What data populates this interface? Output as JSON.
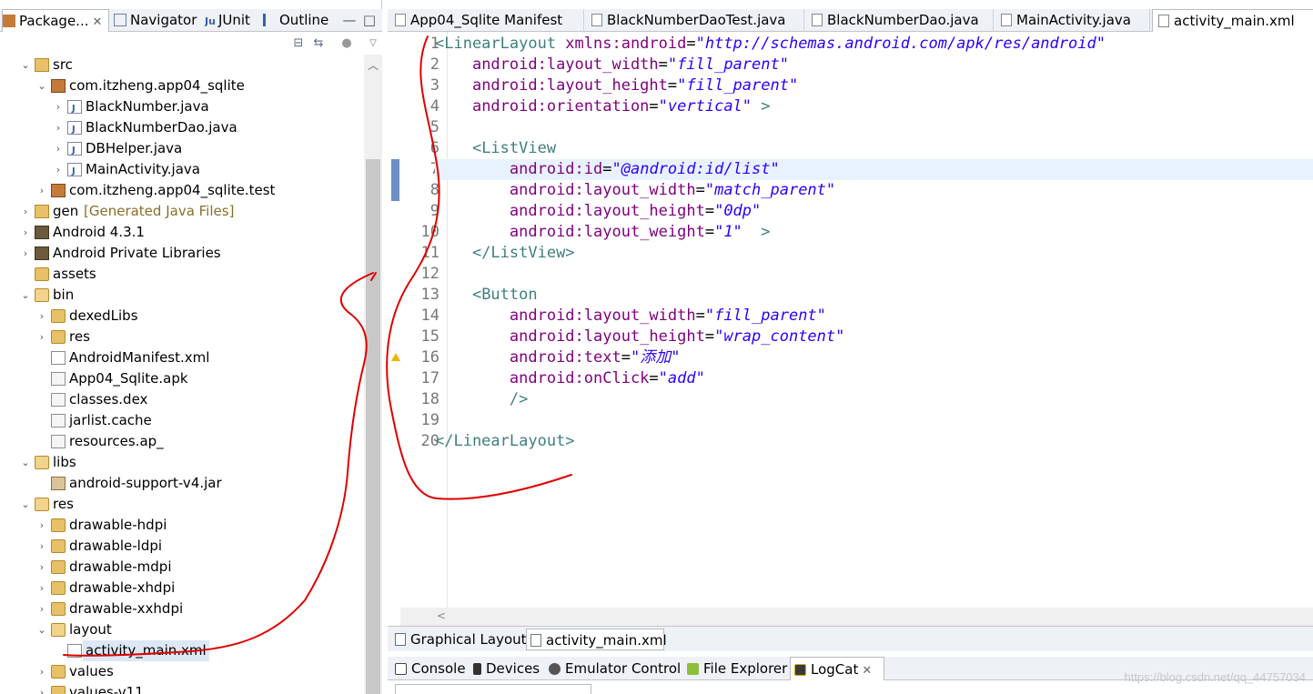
{
  "left_tabs": [
    {
      "label": "Package...",
      "closable": true
    },
    {
      "label": "Navigator"
    },
    {
      "label": "JUnit"
    },
    {
      "label": "Outline"
    }
  ],
  "tree": [
    {
      "label": "src",
      "level": 1,
      "icon": "source-folder-icon",
      "expanded": true
    },
    {
      "label": "com.itzheng.app04_sqlite",
      "level": 2,
      "icon": "package-icon",
      "expanded": true
    },
    {
      "label": "BlackNumber.java",
      "level": 3,
      "icon": "java-file-icon"
    },
    {
      "label": "BlackNumberDao.java",
      "level": 3,
      "icon": "java-file-icon"
    },
    {
      "label": "DBHelper.java",
      "level": 3,
      "icon": "java-file-icon"
    },
    {
      "label": "MainActivity.java",
      "level": 3,
      "icon": "java-file-icon"
    },
    {
      "label": "com.itzheng.app04_sqlite.test",
      "level": 2,
      "icon": "package-icon"
    },
    {
      "label": "gen",
      "decoration": "[Generated Java Files]",
      "level": 1,
      "icon": "source-folder-icon"
    },
    {
      "label": "Android 4.3.1",
      "level": 1,
      "icon": "library-icon"
    },
    {
      "label": "Android Private Libraries",
      "level": 1,
      "icon": "library-icon"
    },
    {
      "label": "assets",
      "level": 1,
      "icon": "folder-icon"
    },
    {
      "label": "bin",
      "level": 1,
      "icon": "open-folder-icon",
      "expanded": true
    },
    {
      "label": "dexedLibs",
      "level": 2,
      "icon": "folder-icon"
    },
    {
      "label": "res",
      "level": 2,
      "icon": "folder-icon"
    },
    {
      "label": "AndroidManifest.xml",
      "level": 2,
      "icon": "xml-file-icon"
    },
    {
      "label": "App04_Sqlite.apk",
      "level": 2,
      "icon": "file-icon"
    },
    {
      "label": "classes.dex",
      "level": 2,
      "icon": "file-icon"
    },
    {
      "label": "jarlist.cache",
      "level": 2,
      "icon": "file-icon"
    },
    {
      "label": "resources.ap_",
      "level": 2,
      "icon": "file-icon"
    },
    {
      "label": "libs",
      "level": 1,
      "icon": "open-folder-icon",
      "expanded": true
    },
    {
      "label": "android-support-v4.jar",
      "level": 2,
      "icon": "jar-icon"
    },
    {
      "label": "res",
      "level": 1,
      "icon": "open-folder-icon",
      "expanded": true
    },
    {
      "label": "drawable-hdpi",
      "level": 2,
      "icon": "folder-icon"
    },
    {
      "label": "drawable-ldpi",
      "level": 2,
      "icon": "folder-icon"
    },
    {
      "label": "drawable-mdpi",
      "level": 2,
      "icon": "folder-icon"
    },
    {
      "label": "drawable-xhdpi",
      "level": 2,
      "icon": "folder-icon"
    },
    {
      "label": "drawable-xxhdpi",
      "level": 2,
      "icon": "folder-icon"
    },
    {
      "label": "layout",
      "level": 2,
      "icon": "open-folder-icon",
      "expanded": true
    },
    {
      "label": "activity_main.xml",
      "level": 3,
      "icon": "xml-file-icon",
      "selected": true
    },
    {
      "label": "values",
      "level": 2,
      "icon": "folder-icon"
    },
    {
      "label": "values-v11",
      "level": 2,
      "icon": "folder-icon"
    }
  ],
  "editor_tabs": [
    {
      "label": "App04_Sqlite Manifest"
    },
    {
      "label": "BlackNumberDaoTest.java"
    },
    {
      "label": "BlackNumberDao.java"
    },
    {
      "label": "MainActivity.java"
    },
    {
      "label": "activity_main.xml",
      "active": true
    }
  ],
  "code_lines": [
    {
      "n": "1",
      "tokens": [
        [
          "tag",
          "<LinearLayout "
        ],
        [
          "attr",
          "xmlns:android"
        ],
        [
          "punc",
          "="
        ],
        [
          "val",
          "\"http://schemas.android.com/apk/res/android\""
        ]
      ]
    },
    {
      "n": "2",
      "tokens": [
        [
          "punc",
          "    "
        ],
        [
          "attr",
          "android:layout_width"
        ],
        [
          "punc",
          "="
        ],
        [
          "val",
          "\"fill_parent\""
        ]
      ]
    },
    {
      "n": "3",
      "tokens": [
        [
          "punc",
          "    "
        ],
        [
          "attr",
          "android:layout_height"
        ],
        [
          "punc",
          "="
        ],
        [
          "val",
          "\"fill_parent\""
        ]
      ]
    },
    {
      "n": "4",
      "tokens": [
        [
          "punc",
          "    "
        ],
        [
          "attr",
          "android:orientation"
        ],
        [
          "punc",
          "="
        ],
        [
          "val",
          "\"vertical\""
        ],
        [
          "punc",
          " "
        ],
        [
          "tag",
          ">"
        ]
      ]
    },
    {
      "n": "5",
      "tokens": []
    },
    {
      "n": "6",
      "tokens": [
        [
          "punc",
          "    "
        ],
        [
          "tag",
          "<ListView"
        ]
      ]
    },
    {
      "n": "7",
      "tokens": [
        [
          "punc",
          "        "
        ],
        [
          "attr",
          "android:id"
        ],
        [
          "punc",
          "="
        ],
        [
          "val",
          "\"@android:id/list\""
        ]
      ],
      "current": true
    },
    {
      "n": "8",
      "tokens": [
        [
          "punc",
          "        "
        ],
        [
          "attr",
          "android:layout_width"
        ],
        [
          "punc",
          "="
        ],
        [
          "val",
          "\"match_parent\""
        ]
      ]
    },
    {
      "n": "9",
      "tokens": [
        [
          "punc",
          "        "
        ],
        [
          "attr",
          "android:layout_height"
        ],
        [
          "punc",
          "="
        ],
        [
          "val",
          "\"0dp\""
        ]
      ]
    },
    {
      "n": "10",
      "tokens": [
        [
          "punc",
          "        "
        ],
        [
          "attr",
          "android:layout_weight"
        ],
        [
          "punc",
          "="
        ],
        [
          "val",
          "\"1\""
        ],
        [
          "punc",
          "  "
        ],
        [
          "tag",
          ">"
        ]
      ]
    },
    {
      "n": "11",
      "tokens": [
        [
          "punc",
          "    "
        ],
        [
          "tag",
          "</ListView>"
        ]
      ]
    },
    {
      "n": "12",
      "tokens": []
    },
    {
      "n": "13",
      "tokens": [
        [
          "punc",
          "    "
        ],
        [
          "tag",
          "<Button"
        ]
      ]
    },
    {
      "n": "14",
      "tokens": [
        [
          "punc",
          "        "
        ],
        [
          "attr",
          "android:layout_width"
        ],
        [
          "punc",
          "="
        ],
        [
          "val",
          "\"fill_parent\""
        ]
      ]
    },
    {
      "n": "15",
      "tokens": [
        [
          "punc",
          "        "
        ],
        [
          "attr",
          "android:layout_height"
        ],
        [
          "punc",
          "="
        ],
        [
          "val",
          "\"wrap_content\""
        ]
      ]
    },
    {
      "n": "16",
      "tokens": [
        [
          "punc",
          "        "
        ],
        [
          "attr",
          "android:text"
        ],
        [
          "punc",
          "="
        ],
        [
          "val",
          "\"添加\""
        ]
      ],
      "warning": true
    },
    {
      "n": "17",
      "tokens": [
        [
          "punc",
          "        "
        ],
        [
          "attr",
          "android:onClick"
        ],
        [
          "punc",
          "="
        ],
        [
          "val",
          "\"add\""
        ]
      ]
    },
    {
      "n": "18",
      "tokens": [
        [
          "punc",
          "        "
        ],
        [
          "tag",
          "/>"
        ]
      ]
    },
    {
      "n": "19",
      "tokens": []
    },
    {
      "n": "20",
      "tokens": [
        [
          "tag",
          "</LinearLayout>"
        ]
      ]
    }
  ],
  "editor_bottom_tabs": [
    {
      "label": "Graphical Layout"
    },
    {
      "label": "activity_main.xml",
      "active": true
    }
  ],
  "console_tabs": [
    {
      "label": "Console",
      "icon": "console-icon"
    },
    {
      "label": "Devices",
      "icon": "device-icon"
    },
    {
      "label": "Emulator Control",
      "icon": "emulator-icon"
    },
    {
      "label": "File Explorer",
      "icon": "android-icon"
    },
    {
      "label": "LogCat",
      "icon": "logcat-icon",
      "active": true,
      "closable": true
    }
  ],
  "watermark": "https://blog.csdn.net/qq_44757034",
  "colors": {
    "xml_tag": "#3f7f7f",
    "xml_attr": "#7f007f",
    "xml_value": "#2a00ff",
    "annotation_stroke": "#e00000",
    "current_line": "#e8f2fe"
  }
}
